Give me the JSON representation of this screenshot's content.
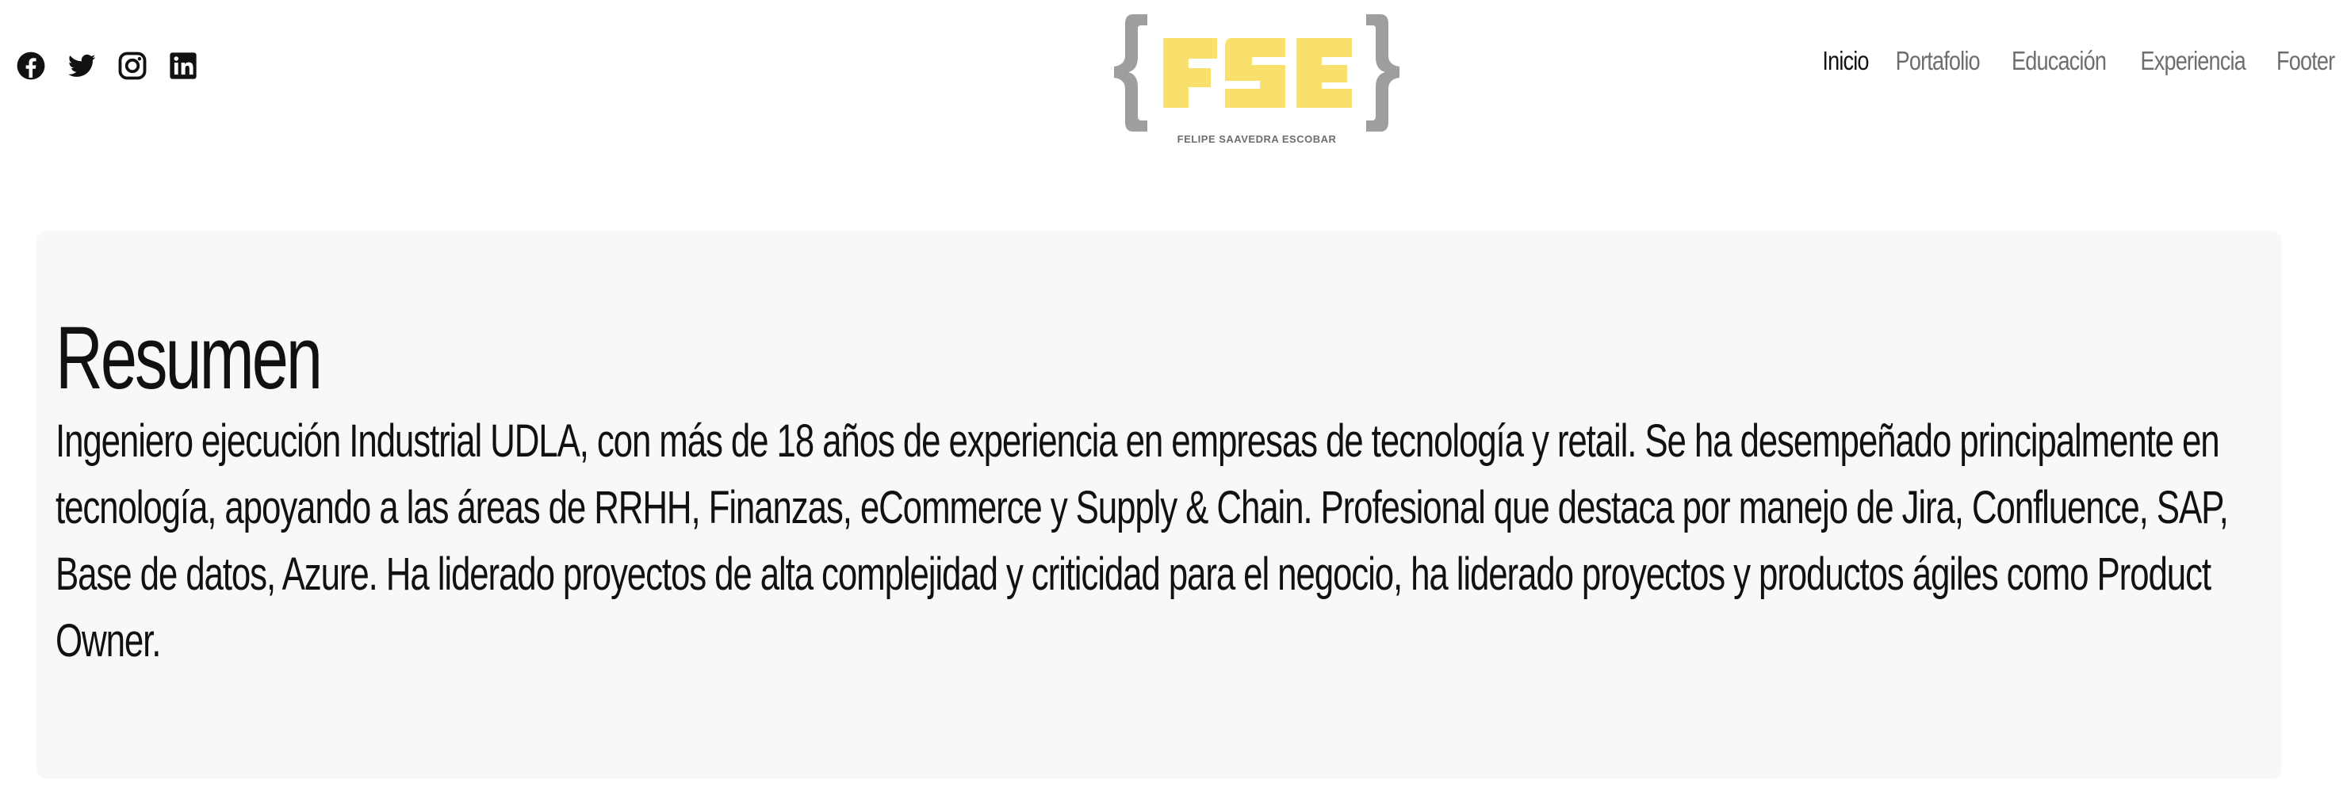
{
  "header": {
    "social": [
      {
        "name": "facebook-icon",
        "label": "Facebook"
      },
      {
        "name": "twitter-icon",
        "label": "Twitter"
      },
      {
        "name": "instagram-icon",
        "label": "Instagram"
      },
      {
        "name": "linkedin-icon",
        "label": "LinkedIn"
      }
    ],
    "logo": {
      "mark": "FSE",
      "subtitle": "FELIPE SAAVEDRA ESCOBAR",
      "mark_color": "#f9df6b",
      "brace_color": "#9e9e9e",
      "subtitle_color": "#6e6e6e"
    },
    "nav": [
      {
        "label": "Inicio",
        "active": true
      },
      {
        "label": "Portafolio",
        "active": false
      },
      {
        "label": "Educación",
        "active": false
      },
      {
        "label": "Experiencia",
        "active": false
      },
      {
        "label": "Footer",
        "active": false
      }
    ]
  },
  "summary": {
    "title": "Resumen",
    "body": "Ingeniero ejecución Industrial UDLA, con más de 18 años de experiencia en empresas de tecnología y retail. Se ha desempeñado principalmente en tecnología, apoyando a las áreas de RRHH, Finanzas, eCommerce y Supply & Chain. Profesional que destaca por manejo de Jira, Confluence, SAP, Base de datos, Azure. Ha liderado proyectos de alta complejidad y criticidad para el negocio, ha liderado proyectos y productos ágiles como Product Owner."
  }
}
